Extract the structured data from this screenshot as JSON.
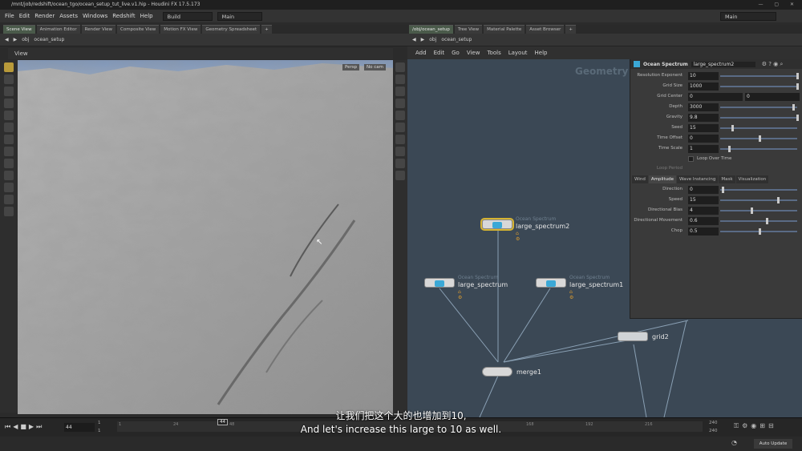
{
  "window": {
    "title": "/mnt/job/redshift/ocean_tgo/ocean_setup_tut_live.v1.hip - Houdini FX 17.5.173"
  },
  "menubar": {
    "items": [
      "File",
      "Edit",
      "Render",
      "Assets",
      "Windows",
      "Redshift",
      "Help"
    ],
    "build_label": "Build",
    "desktop_label": "Main",
    "right_desktop_label": "Main"
  },
  "left_panel": {
    "tabs": [
      "Scene View",
      "Animation Editor",
      "Render View",
      "Composite View",
      "Motion FX View",
      "Geometry Spreadsheet"
    ],
    "path_root": "obj",
    "path_node": "ocean_setup",
    "view_label": "View",
    "persp_label": "Persp",
    "cam_label": "No cam"
  },
  "right_panel": {
    "tabs": [
      "/obj/ocean_setup",
      "Tree View",
      "Material Palette",
      "Asset Browser"
    ],
    "path_root": "obj",
    "path_node": "ocean_setup",
    "menu": [
      "Add",
      "Edit",
      "Go",
      "View",
      "Tools",
      "Layout",
      "Help"
    ],
    "context_label": "Geometry"
  },
  "nodes": {
    "spectrum2_type": "Ocean Spectrum",
    "spectrum2_name": "large_spectrum2",
    "spectrum_type": "Ocean Spectrum",
    "spectrum_name": "large_spectrum",
    "spectrum1_type": "Ocean Spectrum",
    "spectrum1_name": "large_spectrum1",
    "grid_name": "grid2",
    "merge_name": "merge1"
  },
  "params": {
    "op_type": "Ocean Spectrum",
    "op_name": "large_spectrum2",
    "resolution_exponent_label": "Resolution Exponent",
    "resolution_exponent": "10",
    "grid_size_label": "Grid Size",
    "grid_size": "1000",
    "grid_center_label": "Grid Center",
    "grid_center_x": "0",
    "grid_center_y": "0",
    "depth_label": "Depth",
    "depth": "3000",
    "gravity_label": "Gravity",
    "gravity": "9.8",
    "seed_label": "Seed",
    "seed": "15",
    "time_offset_label": "Time Offset",
    "time_offset": "0",
    "time_scale_label": "Time Scale",
    "time_scale": "1",
    "loop_over_time_label": "Loop Over Time",
    "loop_period_label": "Loop Period",
    "tabs": [
      "Wind",
      "Amplitude",
      "Wave Instancing",
      "Mask",
      "Visualization"
    ],
    "direction_label": "Direction",
    "direction": "0",
    "speed_label": "Speed",
    "speed": "15",
    "directional_bias_label": "Directional Bias",
    "directional_bias": "4",
    "directional_movement_label": "Directional Movement",
    "directional_movement": "0.6",
    "chop_label": "Chop",
    "chop": "0.5"
  },
  "timeline": {
    "current_frame": "44",
    "start_frame": "1",
    "start_frame2": "1",
    "end_frame": "240",
    "end_frame2": "240",
    "ticks": [
      "1",
      "24",
      "48",
      "168",
      "192",
      "216"
    ],
    "marker": "44"
  },
  "status": {
    "auto_update": "Auto Update"
  },
  "subtitle": {
    "zh": "让我们把这个大的也增加到10,",
    "en": "And let's increase this large to 10 as well."
  }
}
